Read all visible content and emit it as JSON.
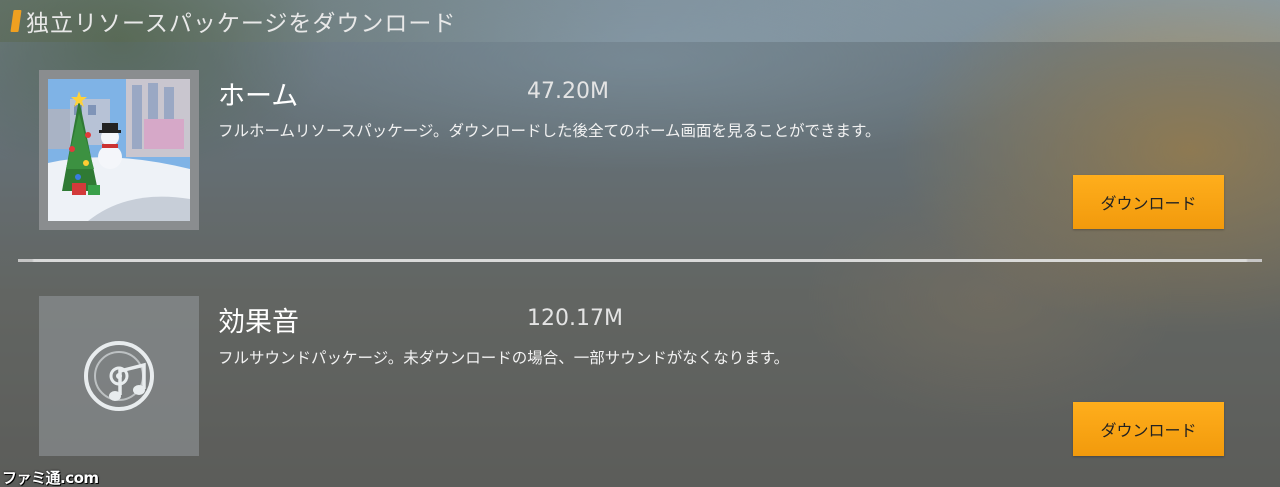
{
  "header": {
    "title": "独立リソースパッケージをダウンロード",
    "accent_color": "#f0a020"
  },
  "packages": [
    {
      "name": "ホーム",
      "size": "47.20M",
      "description": "フルホームリソースパッケージ。ダウンロードした後全てのホーム画面を見ることができます。",
      "button_label": "ダウンロード",
      "thumbnail_icon": "christmas-scene-thumbnail"
    },
    {
      "name": "効果音",
      "size": "120.17M",
      "description": "フルサウンドパッケージ。未ダウンロードの場合、一部サウンドがなくなります。",
      "button_label": "ダウンロード",
      "thumbnail_icon": "music-disc-icon"
    }
  ],
  "watermark": "ファミ通.com",
  "colors": {
    "button": "#f6a214",
    "button_text": "#222222"
  }
}
